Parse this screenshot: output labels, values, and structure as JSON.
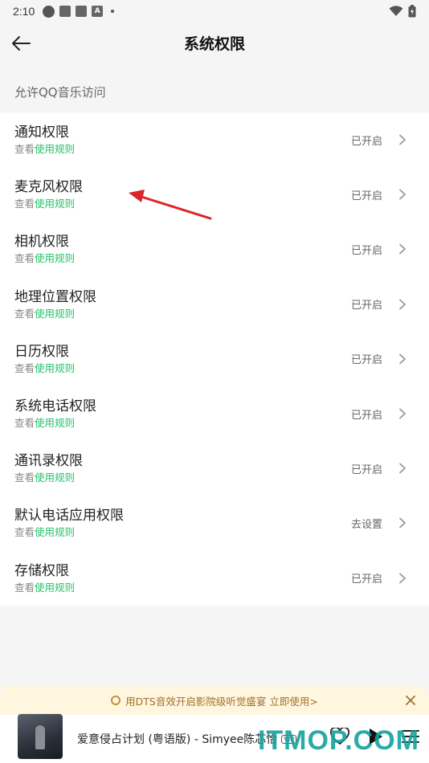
{
  "status_bar": {
    "time": "2:10",
    "a_icon_letter": "A"
  },
  "header": {
    "title": "系统权限",
    "back_icon": "arrow-left-icon"
  },
  "section": {
    "label": "允许QQ音乐访问"
  },
  "permissions": [
    {
      "title": "通知权限",
      "sub_prefix": "查看",
      "sub_link": "使用规则",
      "status": "已开启"
    },
    {
      "title": "麦克风权限",
      "sub_prefix": "查看",
      "sub_link": "使用规则",
      "status": "已开启"
    },
    {
      "title": "相机权限",
      "sub_prefix": "查看",
      "sub_link": "使用规则",
      "status": "已开启"
    },
    {
      "title": "地理位置权限",
      "sub_prefix": "查看",
      "sub_link": "使用规则",
      "status": "已开启"
    },
    {
      "title": "日历权限",
      "sub_prefix": "查看",
      "sub_link": "使用规则",
      "status": "已开启"
    },
    {
      "title": "系统电话权限",
      "sub_prefix": "查看",
      "sub_link": "使用规则",
      "status": "已开启"
    },
    {
      "title": "通讯录权限",
      "sub_prefix": "查看",
      "sub_link": "使用规则",
      "status": "已开启"
    },
    {
      "title": "默认电话应用权限",
      "sub_prefix": "查看",
      "sub_link": "使用规则",
      "status": "去设置"
    },
    {
      "title": "存储权限",
      "sub_prefix": "查看",
      "sub_link": "使用规则",
      "status": "已开启"
    }
  ],
  "banner": {
    "text": "用DTS音效开启影院级听觉盛宴  立即使用>"
  },
  "player": {
    "song": "爱意侵占计划 (粤语版) - Simyee陈芯怡",
    "vip_badge": "VIP"
  },
  "watermark": {
    "text": "ITMOP.COM"
  },
  "colors": {
    "accent_green": "#1ec266",
    "banner_bg": "#fff6df",
    "annotation_red": "#d9262a"
  }
}
